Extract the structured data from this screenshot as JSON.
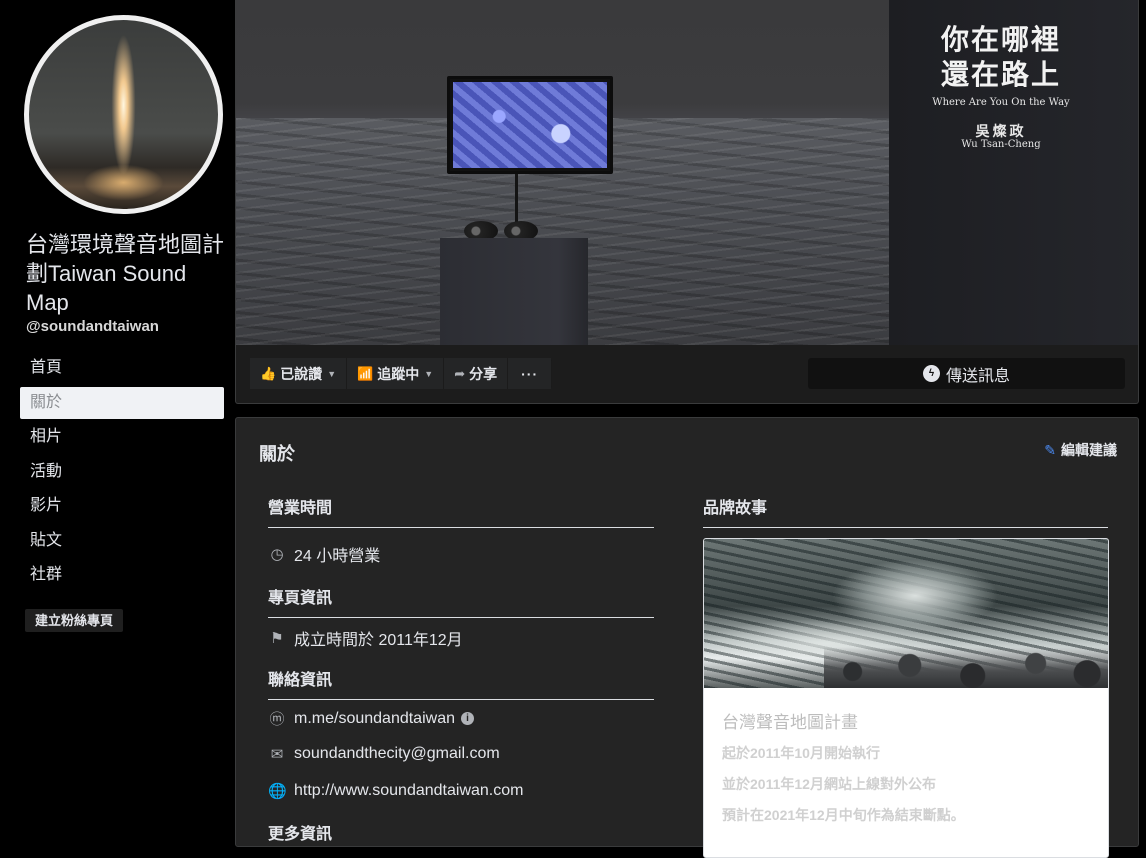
{
  "page": {
    "name": "台灣環境聲音地圖計劃Taiwan Sound Map",
    "handle": "@soundandtaiwan"
  },
  "nav": {
    "items": [
      {
        "label": "首頁"
      },
      {
        "label": "關於",
        "active": true
      },
      {
        "label": "相片"
      },
      {
        "label": "活動"
      },
      {
        "label": "影片"
      },
      {
        "label": "貼文"
      },
      {
        "label": "社群"
      }
    ],
    "create_page_label": "建立粉絲專頁"
  },
  "cover": {
    "title_line1": "你在哪裡",
    "title_line2": "還在路上",
    "title_en": "Where Are You  On the Way",
    "artist": "吳燦政",
    "artist_en": "Wu Tsan-Cheng"
  },
  "actions": {
    "liked_label": "已說讚",
    "following_label": "追蹤中",
    "share_label": "分享",
    "more_label": "···",
    "message_label": "傳送訊息"
  },
  "about": {
    "title": "關於",
    "edit_label": "編輯建議",
    "hours_heading": "營業時間",
    "hours_value": "24 小時營業",
    "page_info_heading": "專頁資訊",
    "founded": "成立時間於 2011年12月",
    "contact_heading": "聯絡資訊",
    "messenger": "m.me/soundandtaiwan",
    "email": "soundandthecity@gmail.com",
    "website": "http://www.soundandtaiwan.com",
    "more_heading": "更多資訊",
    "brand_story_heading": "品牌故事",
    "story_title": "台灣聲音地圖計畫",
    "story_line1": "起於2011年10月開始執行",
    "story_line2": "並於2011年12月網站上線對外公布",
    "story_line3": "預計在2021年12月中旬作為結束斷點。"
  },
  "colors": {
    "background": "#000000",
    "card": "#242424",
    "accent_blue": "#4c8cf5",
    "text": "#e4e6eb"
  }
}
